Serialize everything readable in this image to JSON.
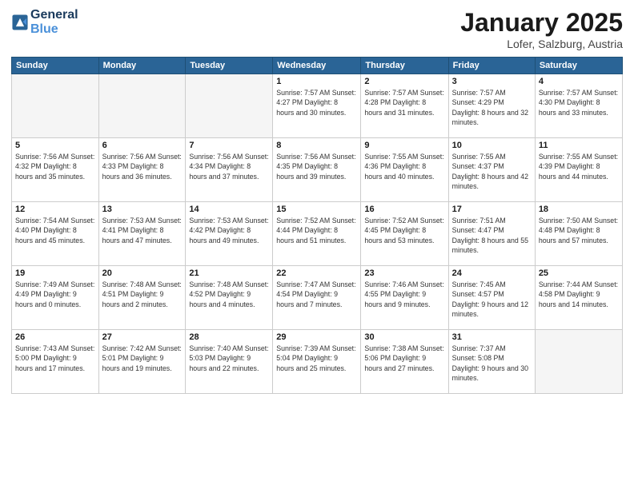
{
  "logo": {
    "line1": "General",
    "line2": "Blue"
  },
  "header": {
    "month": "January 2025",
    "location": "Lofer, Salzburg, Austria"
  },
  "weekdays": [
    "Sunday",
    "Monday",
    "Tuesday",
    "Wednesday",
    "Thursday",
    "Friday",
    "Saturday"
  ],
  "weeks": [
    [
      {
        "day": "",
        "detail": ""
      },
      {
        "day": "",
        "detail": ""
      },
      {
        "day": "",
        "detail": ""
      },
      {
        "day": "1",
        "detail": "Sunrise: 7:57 AM\nSunset: 4:27 PM\nDaylight: 8 hours\nand 30 minutes."
      },
      {
        "day": "2",
        "detail": "Sunrise: 7:57 AM\nSunset: 4:28 PM\nDaylight: 8 hours\nand 31 minutes."
      },
      {
        "day": "3",
        "detail": "Sunrise: 7:57 AM\nSunset: 4:29 PM\nDaylight: 8 hours\nand 32 minutes."
      },
      {
        "day": "4",
        "detail": "Sunrise: 7:57 AM\nSunset: 4:30 PM\nDaylight: 8 hours\nand 33 minutes."
      }
    ],
    [
      {
        "day": "5",
        "detail": "Sunrise: 7:56 AM\nSunset: 4:32 PM\nDaylight: 8 hours\nand 35 minutes."
      },
      {
        "day": "6",
        "detail": "Sunrise: 7:56 AM\nSunset: 4:33 PM\nDaylight: 8 hours\nand 36 minutes."
      },
      {
        "day": "7",
        "detail": "Sunrise: 7:56 AM\nSunset: 4:34 PM\nDaylight: 8 hours\nand 37 minutes."
      },
      {
        "day": "8",
        "detail": "Sunrise: 7:56 AM\nSunset: 4:35 PM\nDaylight: 8 hours\nand 39 minutes."
      },
      {
        "day": "9",
        "detail": "Sunrise: 7:55 AM\nSunset: 4:36 PM\nDaylight: 8 hours\nand 40 minutes."
      },
      {
        "day": "10",
        "detail": "Sunrise: 7:55 AM\nSunset: 4:37 PM\nDaylight: 8 hours\nand 42 minutes."
      },
      {
        "day": "11",
        "detail": "Sunrise: 7:55 AM\nSunset: 4:39 PM\nDaylight: 8 hours\nand 44 minutes."
      }
    ],
    [
      {
        "day": "12",
        "detail": "Sunrise: 7:54 AM\nSunset: 4:40 PM\nDaylight: 8 hours\nand 45 minutes."
      },
      {
        "day": "13",
        "detail": "Sunrise: 7:53 AM\nSunset: 4:41 PM\nDaylight: 8 hours\nand 47 minutes."
      },
      {
        "day": "14",
        "detail": "Sunrise: 7:53 AM\nSunset: 4:42 PM\nDaylight: 8 hours\nand 49 minutes."
      },
      {
        "day": "15",
        "detail": "Sunrise: 7:52 AM\nSunset: 4:44 PM\nDaylight: 8 hours\nand 51 minutes."
      },
      {
        "day": "16",
        "detail": "Sunrise: 7:52 AM\nSunset: 4:45 PM\nDaylight: 8 hours\nand 53 minutes."
      },
      {
        "day": "17",
        "detail": "Sunrise: 7:51 AM\nSunset: 4:47 PM\nDaylight: 8 hours\nand 55 minutes."
      },
      {
        "day": "18",
        "detail": "Sunrise: 7:50 AM\nSunset: 4:48 PM\nDaylight: 8 hours\nand 57 minutes."
      }
    ],
    [
      {
        "day": "19",
        "detail": "Sunrise: 7:49 AM\nSunset: 4:49 PM\nDaylight: 9 hours\nand 0 minutes."
      },
      {
        "day": "20",
        "detail": "Sunrise: 7:48 AM\nSunset: 4:51 PM\nDaylight: 9 hours\nand 2 minutes."
      },
      {
        "day": "21",
        "detail": "Sunrise: 7:48 AM\nSunset: 4:52 PM\nDaylight: 9 hours\nand 4 minutes."
      },
      {
        "day": "22",
        "detail": "Sunrise: 7:47 AM\nSunset: 4:54 PM\nDaylight: 9 hours\nand 7 minutes."
      },
      {
        "day": "23",
        "detail": "Sunrise: 7:46 AM\nSunset: 4:55 PM\nDaylight: 9 hours\nand 9 minutes."
      },
      {
        "day": "24",
        "detail": "Sunrise: 7:45 AM\nSunset: 4:57 PM\nDaylight: 9 hours\nand 12 minutes."
      },
      {
        "day": "25",
        "detail": "Sunrise: 7:44 AM\nSunset: 4:58 PM\nDaylight: 9 hours\nand 14 minutes."
      }
    ],
    [
      {
        "day": "26",
        "detail": "Sunrise: 7:43 AM\nSunset: 5:00 PM\nDaylight: 9 hours\nand 17 minutes."
      },
      {
        "day": "27",
        "detail": "Sunrise: 7:42 AM\nSunset: 5:01 PM\nDaylight: 9 hours\nand 19 minutes."
      },
      {
        "day": "28",
        "detail": "Sunrise: 7:40 AM\nSunset: 5:03 PM\nDaylight: 9 hours\nand 22 minutes."
      },
      {
        "day": "29",
        "detail": "Sunrise: 7:39 AM\nSunset: 5:04 PM\nDaylight: 9 hours\nand 25 minutes."
      },
      {
        "day": "30",
        "detail": "Sunrise: 7:38 AM\nSunset: 5:06 PM\nDaylight: 9 hours\nand 27 minutes."
      },
      {
        "day": "31",
        "detail": "Sunrise: 7:37 AM\nSunset: 5:08 PM\nDaylight: 9 hours\nand 30 minutes."
      },
      {
        "day": "",
        "detail": ""
      }
    ]
  ]
}
